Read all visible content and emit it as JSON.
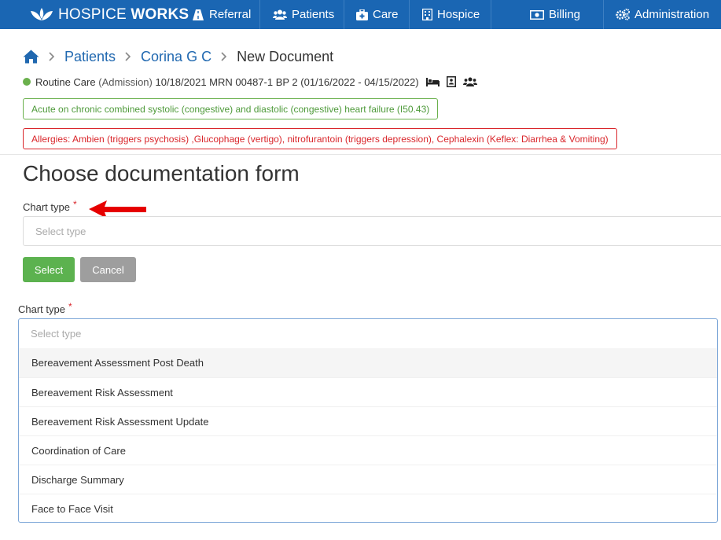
{
  "nav": {
    "brand_light": "HOSPICE",
    "brand_bold": "WORKS",
    "items": [
      {
        "label": "Referral",
        "icon": "road-icon"
      },
      {
        "label": "Patients",
        "icon": "users-icon"
      },
      {
        "label": "Care",
        "icon": "medkit-icon"
      },
      {
        "label": "Hospice",
        "icon": "hospital-icon"
      },
      {
        "label": "Billing",
        "icon": "money-icon"
      },
      {
        "label": "Administration",
        "icon": "gears-icon"
      }
    ]
  },
  "breadcrumb": {
    "home_icon": "home-icon",
    "patients": "Patients",
    "patient_name": "Corina G C",
    "current": "New Document"
  },
  "patient": {
    "status_color": "#6ab04c",
    "care_type": "Routine Care",
    "admission": "(Admission)",
    "details": "10/18/2021 MRN 00487-1 BP 2 (01/16/2022 - 04/15/2022)",
    "icons": [
      "bed-icon",
      "contact-card-icon",
      "family-icon"
    ]
  },
  "diagnosis": "Acute on chronic combined systolic (congestive) and diastolic (congestive) heart failure (I50.43)",
  "allergies": "Allergies: Ambien (triggers psychosis) ,Glucophage (vertigo), nitrofurantoin (triggers depression), Cephalexin (Keflex: Diarrhea & Vomiting)",
  "form": {
    "heading": "Choose documentation form",
    "chart_type_label": "Chart type",
    "required_mark": "*",
    "placeholder": "Select type",
    "select_button": "Select",
    "cancel_button": "Cancel"
  },
  "dropdown": {
    "label": "Chart type",
    "required_mark": "*",
    "placeholder": "Select type",
    "options": [
      "Bereavement Assessment Post Death",
      "Bereavement Risk Assessment",
      "Bereavement Risk Assessment Update",
      "Coordination of Care",
      "Discharge Summary",
      "Face to Face Visit"
    ]
  },
  "colors": {
    "navbar": "#1a66b3",
    "link": "#2068b0",
    "success": "#5cb24f",
    "danger": "#d9262b",
    "diagnosis": "#4e9a3a",
    "annotation_arrow": "#e60000"
  }
}
